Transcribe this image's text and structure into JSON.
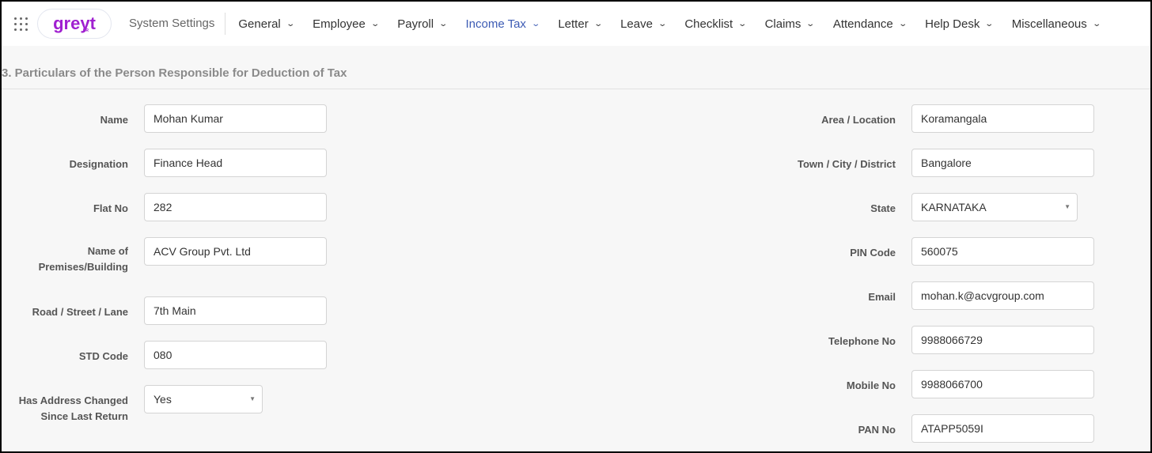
{
  "header": {
    "logo": "greyt",
    "logo_sub": "HR",
    "system_settings": "System Settings",
    "nav": [
      "General",
      "Employee",
      "Payroll",
      "Income Tax",
      "Letter",
      "Leave",
      "Checklist",
      "Claims",
      "Attendance",
      "Help Desk",
      "Miscellaneous"
    ],
    "active": "Income Tax"
  },
  "section_title": "3. Particulars of the Person Responsible for Deduction of Tax",
  "left": [
    {
      "label": "Name",
      "value": "Mohan Kumar"
    },
    {
      "label": "Designation",
      "value": "Finance Head"
    },
    {
      "label": "Flat No",
      "value": "282"
    },
    {
      "label": "Name of Premises/Building",
      "value": "ACV Group Pvt. Ltd"
    },
    {
      "label": "Road / Street / Lane",
      "value": "7th Main"
    },
    {
      "label": "STD Code",
      "value": "080"
    },
    {
      "label": "Has Address Changed Since Last Return",
      "value": "Yes"
    }
  ],
  "right": [
    {
      "label": "Area / Location",
      "value": "Koramangala"
    },
    {
      "label": "Town / City / District",
      "value": "Bangalore"
    },
    {
      "label": "State",
      "value": "KARNATAKA"
    },
    {
      "label": "PIN Code",
      "value": "560075"
    },
    {
      "label": "Email",
      "value": "mohan.k@acvgroup.com"
    },
    {
      "label": "Telephone No",
      "value": "9988066729"
    },
    {
      "label": "Mobile No",
      "value": "9988066700"
    },
    {
      "label": "PAN No",
      "value": "ATAPP5059I"
    }
  ]
}
